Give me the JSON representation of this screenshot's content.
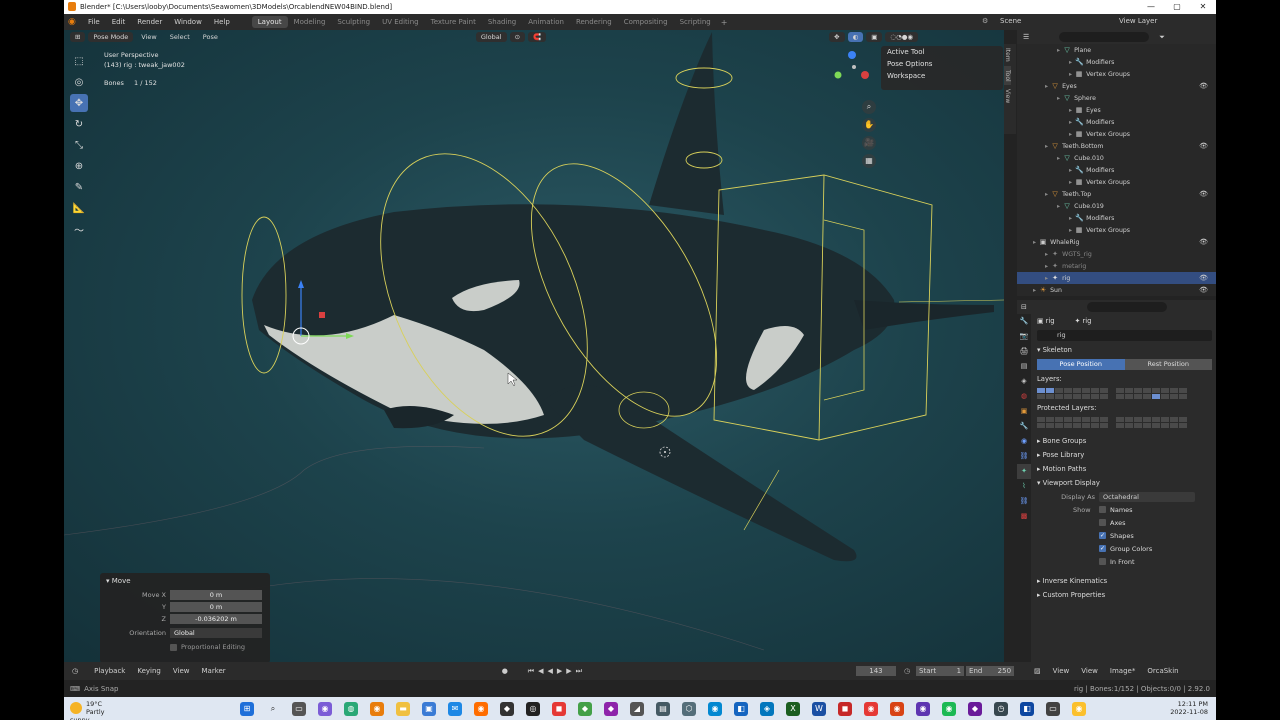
{
  "window": {
    "title": "Blender* [C:\\Users\\looby\\Documents\\Seawomen\\3DModels\\OrcablendNEW04BIND.blend]",
    "min": "—",
    "max": "▢",
    "close": "✕"
  },
  "menu": [
    "File",
    "Edit",
    "Render",
    "Window",
    "Help"
  ],
  "workspaces": [
    "Layout",
    "Modeling",
    "Sculpting",
    "UV Editing",
    "Texture Paint",
    "Shading",
    "Animation",
    "Rendering",
    "Compositing",
    "Scripting"
  ],
  "workspace_active": "Layout",
  "scene": {
    "label": "Scene",
    "view_layer": "View Layer"
  },
  "viewport_header": {
    "mode": "Pose Mode",
    "menus": [
      "View",
      "Select",
      "Pose"
    ],
    "orientation": "Global"
  },
  "viewport": {
    "perspective": "User Perspective",
    "object_info": "(143) rig : tweak_jaw002",
    "bones_label": "Bones",
    "bones_count": "1 / 152"
  },
  "nav_popup": [
    "Active Tool",
    "Pose Options",
    "Workspace"
  ],
  "side_tabs": [
    "Item",
    "Tool",
    "View"
  ],
  "move_panel": {
    "title": "Move",
    "rows": [
      {
        "label": "Move X",
        "value": "0 m"
      },
      {
        "label": "Y",
        "value": "0 m"
      },
      {
        "label": "Z",
        "value": "-0.036202 m"
      }
    ],
    "orientation_label": "Orientation",
    "orientation_value": "Global",
    "proportional": "Proportional Editing"
  },
  "outliner": [
    {
      "indent": 3,
      "icon": "▽",
      "label": "Plane",
      "color": "#6fd0b0"
    },
    {
      "indent": 4,
      "icon": "🔧",
      "label": "Modifiers",
      "color": "#6fa0ff"
    },
    {
      "indent": 4,
      "icon": "▦",
      "label": "Vertex Groups",
      "color": "#cccccc"
    },
    {
      "indent": 2,
      "icon": "▽",
      "label": "Eyes",
      "color": "#e39a3a",
      "eye": "👁"
    },
    {
      "indent": 3,
      "icon": "▽",
      "label": "Sphere",
      "color": "#6fd0b0"
    },
    {
      "indent": 4,
      "icon": "▦",
      "label": "Eyes",
      "color": "#cccccc"
    },
    {
      "indent": 4,
      "icon": "🔧",
      "label": "Modifiers",
      "color": "#6fa0ff"
    },
    {
      "indent": 4,
      "icon": "▦",
      "label": "Vertex Groups",
      "color": "#cccccc"
    },
    {
      "indent": 2,
      "icon": "▽",
      "label": "Teeth.Bottom",
      "color": "#e39a3a",
      "eye": "👁"
    },
    {
      "indent": 3,
      "icon": "▽",
      "label": "Cube.010",
      "color": "#6fd0b0"
    },
    {
      "indent": 4,
      "icon": "🔧",
      "label": "Modifiers",
      "color": "#6fa0ff"
    },
    {
      "indent": 4,
      "icon": "▦",
      "label": "Vertex Groups",
      "color": "#cccccc"
    },
    {
      "indent": 2,
      "icon": "▽",
      "label": "Teeth.Top",
      "color": "#e39a3a",
      "eye": "👁"
    },
    {
      "indent": 3,
      "icon": "▽",
      "label": "Cube.019",
      "color": "#6fd0b0"
    },
    {
      "indent": 4,
      "icon": "🔧",
      "label": "Modifiers",
      "color": "#6fa0ff"
    },
    {
      "indent": 4,
      "icon": "▦",
      "label": "Vertex Groups",
      "color": "#cccccc"
    },
    {
      "indent": 1,
      "icon": "▣",
      "label": "WhaleRig",
      "color": "#cccccc",
      "eye": "👁"
    },
    {
      "indent": 2,
      "icon": "✦",
      "label": "WGTS_rig",
      "color": "#888888"
    },
    {
      "indent": 2,
      "icon": "✦",
      "label": "metarig",
      "color": "#888888"
    },
    {
      "indent": 2,
      "icon": "✦",
      "label": "rig",
      "color": "#e0e0e0",
      "eye": "👁",
      "selected": true
    },
    {
      "indent": 1,
      "icon": "☀",
      "label": "Sun",
      "color": "#e39a3a",
      "eye": "👁"
    }
  ],
  "properties": {
    "object_name": "rig",
    "data_name": "rig",
    "armature_field": "rig",
    "skeleton": "Skeleton",
    "pose_position": "Pose Position",
    "rest_position": "Rest Position",
    "layers": "Layers:",
    "protected_layers": "Protected Layers:",
    "sections": [
      "Bone Groups",
      "Pose Library",
      "Motion Paths"
    ],
    "viewport_display": "Viewport Display",
    "display_as_label": "Display As",
    "display_as_value": "Octahedral",
    "show_label": "Show",
    "show_items": [
      {
        "label": "Names",
        "checked": false
      },
      {
        "label": "Axes",
        "checked": false
      },
      {
        "label": "Shapes",
        "checked": true
      },
      {
        "label": "Group Colors",
        "checked": true
      },
      {
        "label": "In Front",
        "checked": false
      }
    ],
    "bottom_sections": [
      "Inverse Kinematics",
      "Custom Properties"
    ]
  },
  "timeline": {
    "menus": [
      "Playback",
      "Keying",
      "View",
      "Marker"
    ],
    "current_frame": "143",
    "start_label": "Start",
    "start": "1",
    "end_label": "End",
    "end": "250",
    "right_menus": [
      "View",
      "View",
      "Image*"
    ],
    "image": "OrcaSkin"
  },
  "status": {
    "left": "Axis Snap",
    "right": "rig | Bones:1/152 | Objects:0/0 | 2.92.0"
  },
  "taskbar": {
    "temp": "19°C",
    "weather": "Partly sunny",
    "time": "12:11 PM",
    "date": "2022-11-08"
  },
  "colors": {
    "accent": "#4772b3",
    "rig_yellow": "#d8d05a",
    "orca_black": "#1c2b30",
    "orca_white": "#c9cdc9"
  }
}
